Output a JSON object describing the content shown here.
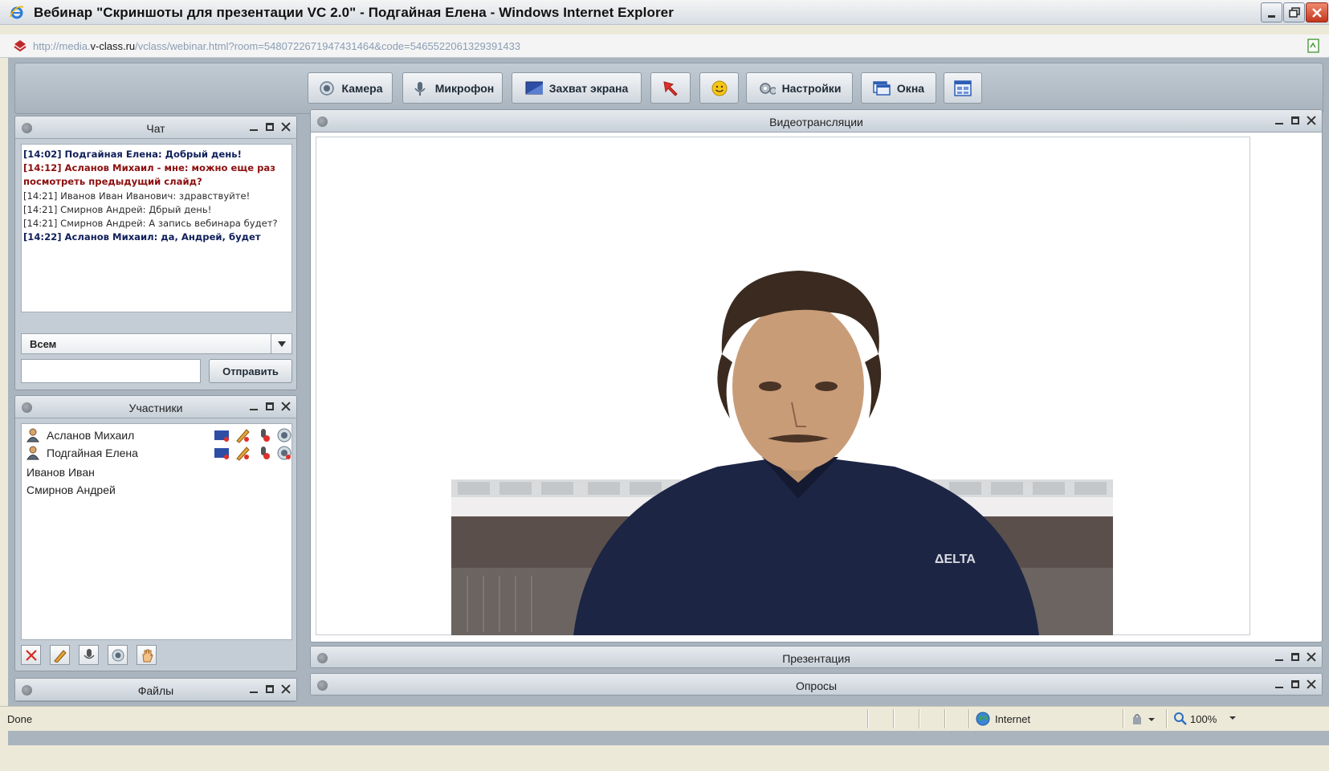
{
  "window": {
    "title": "Вебинар \"Скриншоты для презентации VC 2.0\" - Подгайная Елена - Windows Internet Explorer"
  },
  "address": {
    "prefix": "http://media.",
    "domain": "v-class.ru",
    "path": "/vclass/webinar.html?room=5480722671947431464&code=5465522061329391433"
  },
  "toolbar": {
    "camera_label": "Камера",
    "microphone_label": "Микрофон",
    "screen_capture_label": "Захват экрана",
    "settings_label": "Настройки",
    "windows_label": "Окна"
  },
  "chat": {
    "title": "Чат",
    "messages": [
      {
        "text": "[14:02] Подгайная Елена: Добрый день!"
      },
      {
        "text": "[14:12] Асланов Михаил - мне: можно еще раз посмотреть предыдущий слайд?"
      },
      {
        "text": "[14:21] Иванов Иван Иванович: здравствуйте!"
      },
      {
        "text": "[14:21] Смирнов Андрей: Дбрый день!"
      },
      {
        "text": "[14:21] Смирнов Андрей: А запись вебинара будет?"
      },
      {
        "text": "[14:22] Асланов Михаил: да, Андрей, будет"
      }
    ],
    "recipient": "Всем",
    "input_value": "",
    "send_label": "Отправить"
  },
  "participants": {
    "title": "Участники",
    "list": [
      {
        "name": "Асланов Михаил"
      },
      {
        "name": "Подгайная Елена"
      },
      {
        "name": "Иванов Иван"
      },
      {
        "name": "Смирнов Андрей"
      }
    ]
  },
  "files": {
    "title": "Файлы"
  },
  "video": {
    "title": "Видеотрансляции"
  },
  "presentation": {
    "title": "Презентация"
  },
  "polls": {
    "title": "Опросы"
  },
  "status_bar": {
    "status": "Done",
    "zone": "Internet",
    "zoom": "100%"
  },
  "colors": {
    "app_background": "#a9b4be",
    "chat_highlight_navy": "#0f1f5a",
    "chat_highlight_red": "#8c0f0f",
    "close_button": "#c2361d"
  },
  "icons": [
    "ie-logo-icon",
    "minimize-icon",
    "maximize-icon",
    "close-icon",
    "camera-icon",
    "microphone-icon",
    "screen-capture-icon",
    "pointer-arrow-icon",
    "smiley-icon",
    "gear-icon",
    "windows-icon",
    "grid-layout-icon",
    "user-icon",
    "pencil-icon",
    "globe-icon",
    "zoom-icon"
  ]
}
